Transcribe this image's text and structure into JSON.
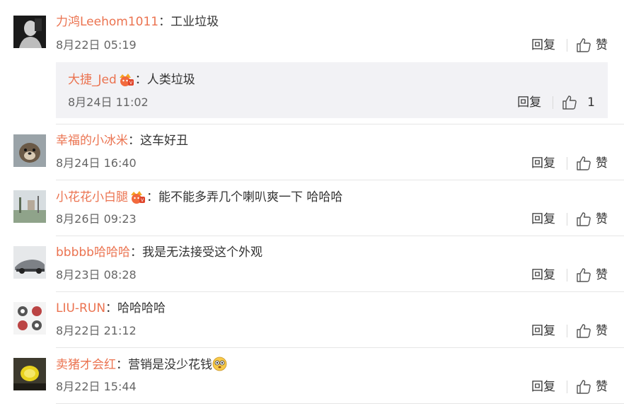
{
  "comments": [
    {
      "user": "力鸿Leehom1011",
      "colon": "：",
      "text": "工业垃圾",
      "time": "8月22日 05:19",
      "reply_label": "回复",
      "like_label": "赞",
      "avatar": "dark-portrait",
      "reply": {
        "user": "大捷_Jed",
        "badge": "vip-crown-badge",
        "colon": "：",
        "text": "人类垃圾",
        "time": "8月24日 11:02",
        "reply_label": "回复",
        "like_count": "1"
      }
    },
    {
      "user": "幸福的小冰米",
      "colon": "：",
      "text": "这车好丑",
      "time": "8月24日 16:40",
      "reply_label": "回复",
      "like_label": "赞",
      "avatar": "otter-photo"
    },
    {
      "user": "小花花小白腿",
      "badge": "vip-crown-badge",
      "colon": "：",
      "text": "能不能多弄几个喇叭爽一下 哈哈哈",
      "time": "8月26日 09:23",
      "reply_label": "回复",
      "like_label": "赞",
      "avatar": "outdoor-photo"
    },
    {
      "user": "bbbbb哈哈哈",
      "colon": "：",
      "text": "我是无法接受这个外观",
      "time": "8月23日 08:28",
      "reply_label": "回复",
      "like_label": "赞",
      "avatar": "car-photo"
    },
    {
      "user": "LIU-RUN",
      "colon": "：",
      "text": "哈哈哈哈",
      "time": "8月22日 21:12",
      "reply_label": "回复",
      "like_label": "赞",
      "avatar": "pattern-tile"
    },
    {
      "user": "卖猪才会红",
      "colon": "：",
      "text": "营销是没少花钱",
      "emoji": "stunned-face-emoji",
      "time": "8月22日 15:44",
      "reply_label": "回复",
      "like_label": "赞",
      "avatar": "lemon-photo"
    }
  ],
  "colors": {
    "username": "#eb7350",
    "text": "#333333",
    "time": "#666666",
    "reply_bg": "#f2f2f5",
    "divider": "#e6e6e6"
  }
}
